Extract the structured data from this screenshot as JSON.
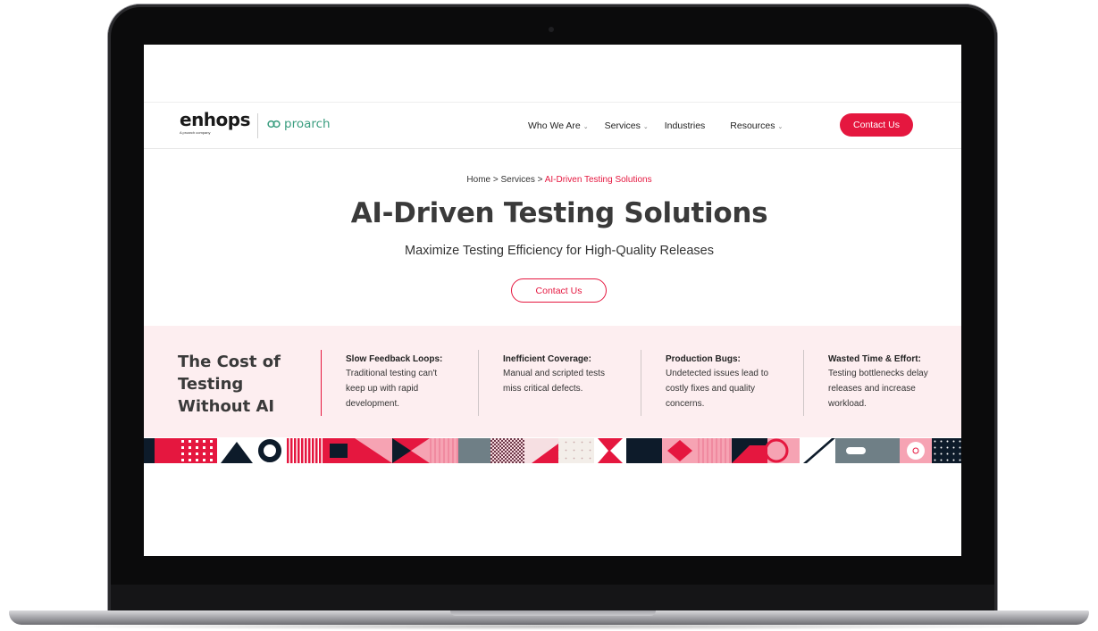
{
  "brand": {
    "logo_text": "enhops",
    "logo_tagline": "A proarch company",
    "partner_name": "proarch"
  },
  "nav": {
    "items": [
      {
        "label": "Who We Are",
        "has_dropdown": true
      },
      {
        "label": "Services",
        "has_dropdown": true
      },
      {
        "label": "Industries",
        "has_dropdown": false
      },
      {
        "label": "Resources",
        "has_dropdown": true
      }
    ],
    "chevron_glyph": "⌄",
    "cta_label": "Contact Us"
  },
  "breadcrumb": {
    "home": "Home",
    "separator": ">",
    "services": "Services",
    "current": "AI-Driven Testing Solutions"
  },
  "hero": {
    "title": "AI-Driven Testing Solutions",
    "subtitle": "Maximize Testing Efficiency for High-Quality Releases",
    "cta_label": "Contact Us"
  },
  "cost_section": {
    "title": "The Cost of Testing Without AI",
    "points": [
      {
        "title": "Slow Feedback Loops:",
        "text": "Traditional testing can't keep up with rapid development."
      },
      {
        "title": "Inefficient Coverage:",
        "text": "Manual and scripted tests miss critical defects."
      },
      {
        "title": "Production Bugs:",
        "text": "Undetected issues lead to costly fixes and quality concerns."
      },
      {
        "title": "Wasted Time & Effort:",
        "text": "Testing bottlenecks delay releases and increase workload."
      }
    ]
  },
  "colors": {
    "accent": "#e5173f",
    "band_background": "#fdeef0",
    "partner_green": "#3a9d7f",
    "pattern_dark": "#0d1b2a",
    "pattern_pink": "#f6a3b3",
    "pattern_gray": "#6f7f86"
  }
}
